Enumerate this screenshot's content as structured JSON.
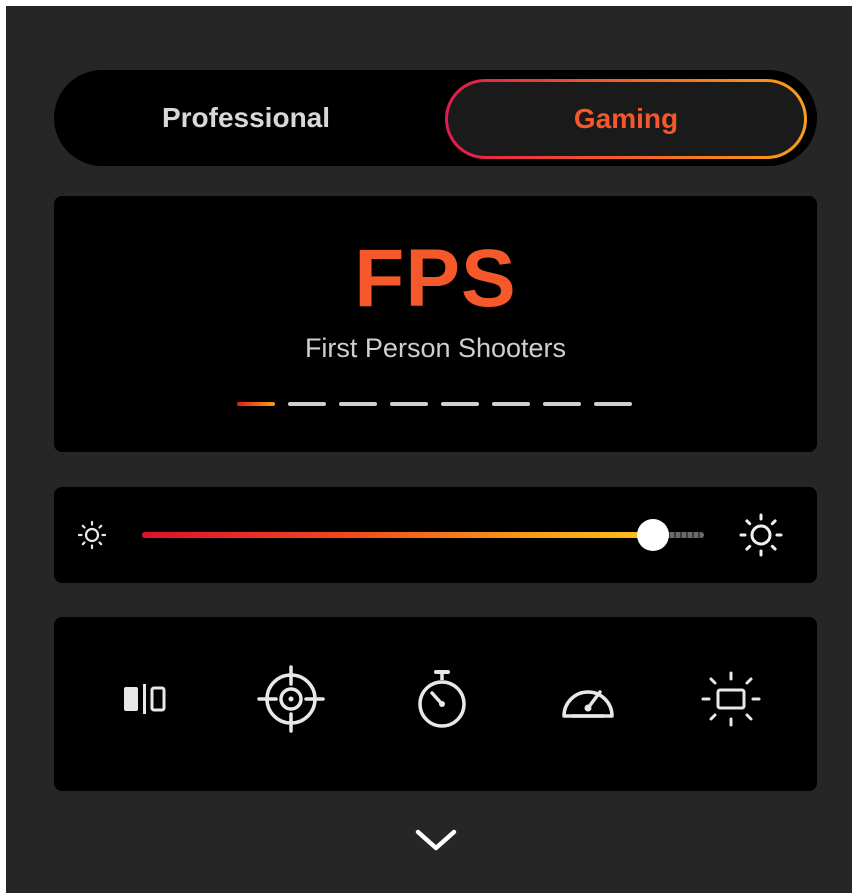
{
  "mode_toggle": {
    "options": [
      "Professional",
      "Gaming"
    ],
    "selected": "Gaming",
    "accent_gradient": [
      "#e01a4f",
      "#f25a2a",
      "#f7a11a"
    ]
  },
  "profile": {
    "title": "FPS",
    "subtitle": "First Person Shooters",
    "page_count": 8,
    "active_index": 0,
    "accent_color": "#f4582b"
  },
  "brightness": {
    "level": 0.91,
    "min_icon": "sun-small-icon",
    "max_icon": "sun-large-icon"
  },
  "tools": [
    {
      "name": "split-screen-icon"
    },
    {
      "name": "crosshair-icon"
    },
    {
      "name": "timer-icon"
    },
    {
      "name": "speedometer-icon"
    },
    {
      "name": "screen-glow-icon"
    }
  ],
  "expand_icon": "chevron-down-icon"
}
